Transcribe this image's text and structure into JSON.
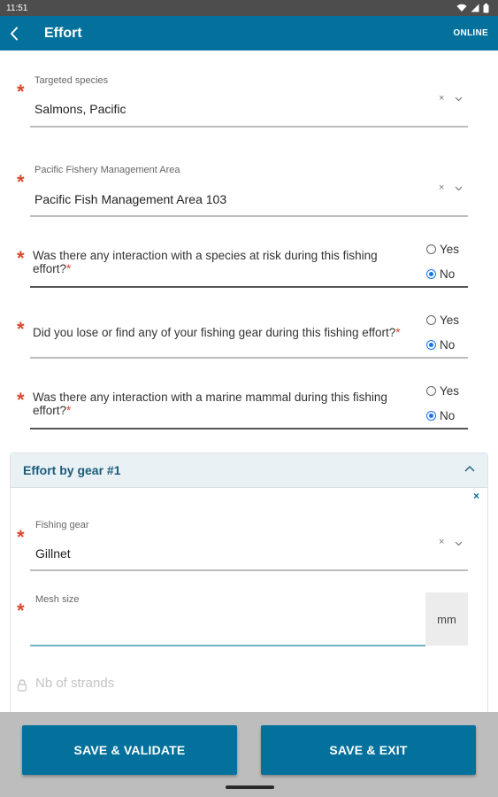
{
  "status_bar": {
    "time": "11:51"
  },
  "app_bar": {
    "title": "Effort",
    "connection_status": "ONLINE"
  },
  "fields": {
    "targeted_species": {
      "label": "Targeted species",
      "value": "Salmons, Pacific",
      "clear_glyph": "×"
    },
    "management_area": {
      "label": "Pacific Fishery Management Area",
      "value": "Pacific Fish Management Area 103",
      "clear_glyph": "×"
    }
  },
  "questions": [
    {
      "text": "Was there any interaction with a species at risk during this fishing effort?",
      "star": "*",
      "options": [
        "Yes",
        "No"
      ],
      "selected": "No"
    },
    {
      "text": "Did you lose or find any of your fishing gear during this fishing effort?",
      "star": "*",
      "options": [
        "Yes",
        "No"
      ],
      "selected": "No"
    },
    {
      "text": "Was there any interaction with a marine mammal during this fishing effort?",
      "star": "*",
      "options": [
        "Yes",
        "No"
      ],
      "selected": "No"
    }
  ],
  "gear_section": {
    "title": "Effort by gear #1",
    "remove_glyph": "×",
    "fishing_gear": {
      "label": "Fishing gear",
      "value": "Gillnet",
      "clear_glyph": "×"
    },
    "mesh_size": {
      "label": "Mesh size",
      "value": "",
      "unit": "mm"
    },
    "strands": {
      "label": "Nb of strands"
    }
  },
  "required_marker": "*",
  "actions": {
    "save_validate": "SAVE & VALIDATE",
    "save_exit": "SAVE & EXIT"
  },
  "colors": {
    "primary": "#03719c",
    "required": "#d9482b",
    "radio_selected": "#1a73e8"
  },
  "icons": {
    "back": "chevron-left-icon",
    "dropdown": "chevron-down-icon",
    "collapse": "chevron-up-icon",
    "lock": "lock-icon"
  }
}
